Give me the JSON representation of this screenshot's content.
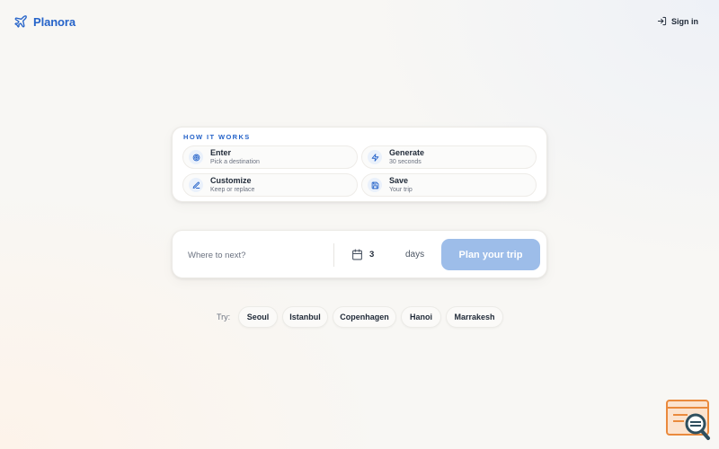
{
  "header": {
    "brand": {
      "name": "Planora",
      "icon": "plane-icon",
      "color": "#2563c9"
    },
    "signin": {
      "label": "Sign in",
      "icon": "log-in-icon"
    }
  },
  "how_it_works": {
    "title": "HOW IT WORKS",
    "steps": [
      {
        "title": "Enter",
        "subtitle": "Pick a destination",
        "icon": "target-icon"
      },
      {
        "title": "Generate",
        "subtitle": "30 seconds",
        "icon": "lightning-icon"
      },
      {
        "title": "Customize",
        "subtitle": "Keep or replace",
        "icon": "pencil-icon"
      },
      {
        "title": "Save",
        "subtitle": "Your trip",
        "icon": "save-icon"
      }
    ]
  },
  "search": {
    "destination_placeholder": "Where to next?",
    "destination_value": "",
    "days_value": "3",
    "days_label": "days",
    "calendar_icon": "calendar-icon",
    "plan_button_label": "Plan your trip",
    "plan_button_color": "#9dbde9"
  },
  "suggestions": {
    "label": "Try:",
    "chips": [
      "Seoul",
      "Istanbul",
      "Copenhagen",
      "Hanoi",
      "Marrakesh"
    ]
  },
  "colors": {
    "accent": "#2563c9",
    "background": "#f8f7f4"
  }
}
